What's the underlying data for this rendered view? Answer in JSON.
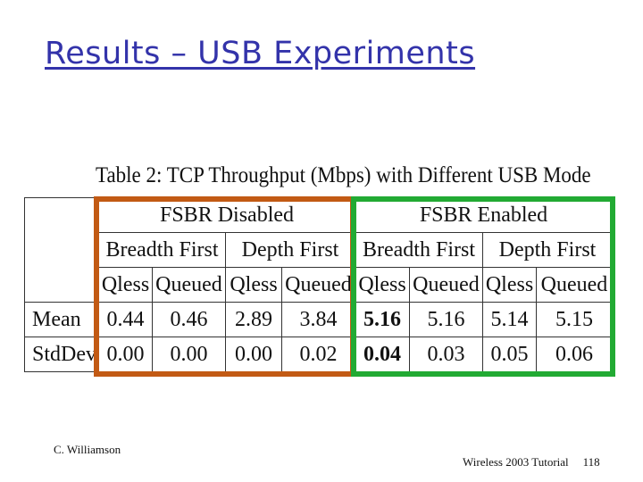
{
  "slide": {
    "title": "Results – USB Experiments"
  },
  "table": {
    "caption": "Table 2: TCP Throughput (Mbps) with Different USB Mode",
    "groups": [
      "FSBR Disabled",
      "FSBR Enabled"
    ],
    "subgroups": [
      "Breadth First",
      "Depth First",
      "Breadth First",
      "Depth First"
    ],
    "columns": [
      "Qless",
      "Queued",
      "Qless",
      "Queued",
      "Qless",
      "Queued",
      "Qless",
      "Queued"
    ],
    "rows": [
      {
        "label": "Mean",
        "values": [
          "0.44",
          "0.46",
          "2.89",
          "3.84",
          "5.16",
          "5.16",
          "5.14",
          "5.15"
        ]
      },
      {
        "label": "StdDev",
        "values": [
          "0.00",
          "0.00",
          "0.00",
          "0.02",
          "0.04",
          "0.03",
          "0.05",
          "0.06"
        ]
      }
    ],
    "highlight_colors": {
      "fsbr_disabled": "#c25a14",
      "fsbr_enabled": "#22aa33"
    }
  },
  "footer": {
    "author": "C. Williamson",
    "event": "Wireless 2003 Tutorial",
    "page_number": "118"
  }
}
